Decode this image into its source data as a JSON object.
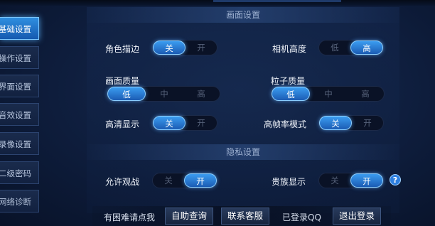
{
  "sidebar": {
    "items": [
      {
        "label": "基础设置",
        "active": true
      },
      {
        "label": "操作设置",
        "active": false
      },
      {
        "label": "界面设置",
        "active": false
      },
      {
        "label": "音效设置",
        "active": false
      },
      {
        "label": "录像设置",
        "active": false
      },
      {
        "label": "二级密码",
        "active": false
      },
      {
        "label": "网络诊断",
        "active": false
      }
    ]
  },
  "sections": {
    "display": "画面设置",
    "privacy": "隐私设置"
  },
  "settings": {
    "role_stroke": {
      "label": "角色描边",
      "options": [
        "关",
        "开"
      ],
      "selected": "关"
    },
    "camera_height": {
      "label": "相机高度",
      "options": [
        "低",
        "高"
      ],
      "selected": "高"
    },
    "quality": {
      "label": "画面质量",
      "options": [
        "低",
        "中",
        "高"
      ],
      "selected": "低"
    },
    "particle": {
      "label": "粒子质量",
      "options": [
        "低",
        "中",
        "高"
      ],
      "selected": "低"
    },
    "hd_display": {
      "label": "高清显示",
      "options": [
        "关",
        "开"
      ],
      "selected": "关"
    },
    "high_fps": {
      "label": "高帧率模式",
      "options": [
        "关",
        "开"
      ],
      "selected": "关"
    },
    "allow_watch": {
      "label": "允许观战",
      "options": [
        "关",
        "开"
      ],
      "selected": "开"
    },
    "noble_display": {
      "label": "贵族显示",
      "options": [
        "关",
        "开"
      ],
      "selected": "开"
    }
  },
  "help_icon": "?",
  "bottom": {
    "help_text": "有困难请点我",
    "self_service": "自助查询",
    "contact": "联系客服",
    "login_status": "已登录QQ",
    "logout": "退出登录"
  },
  "colors": {
    "accent": "#2f8fe0",
    "background": "#0e1d3c"
  }
}
